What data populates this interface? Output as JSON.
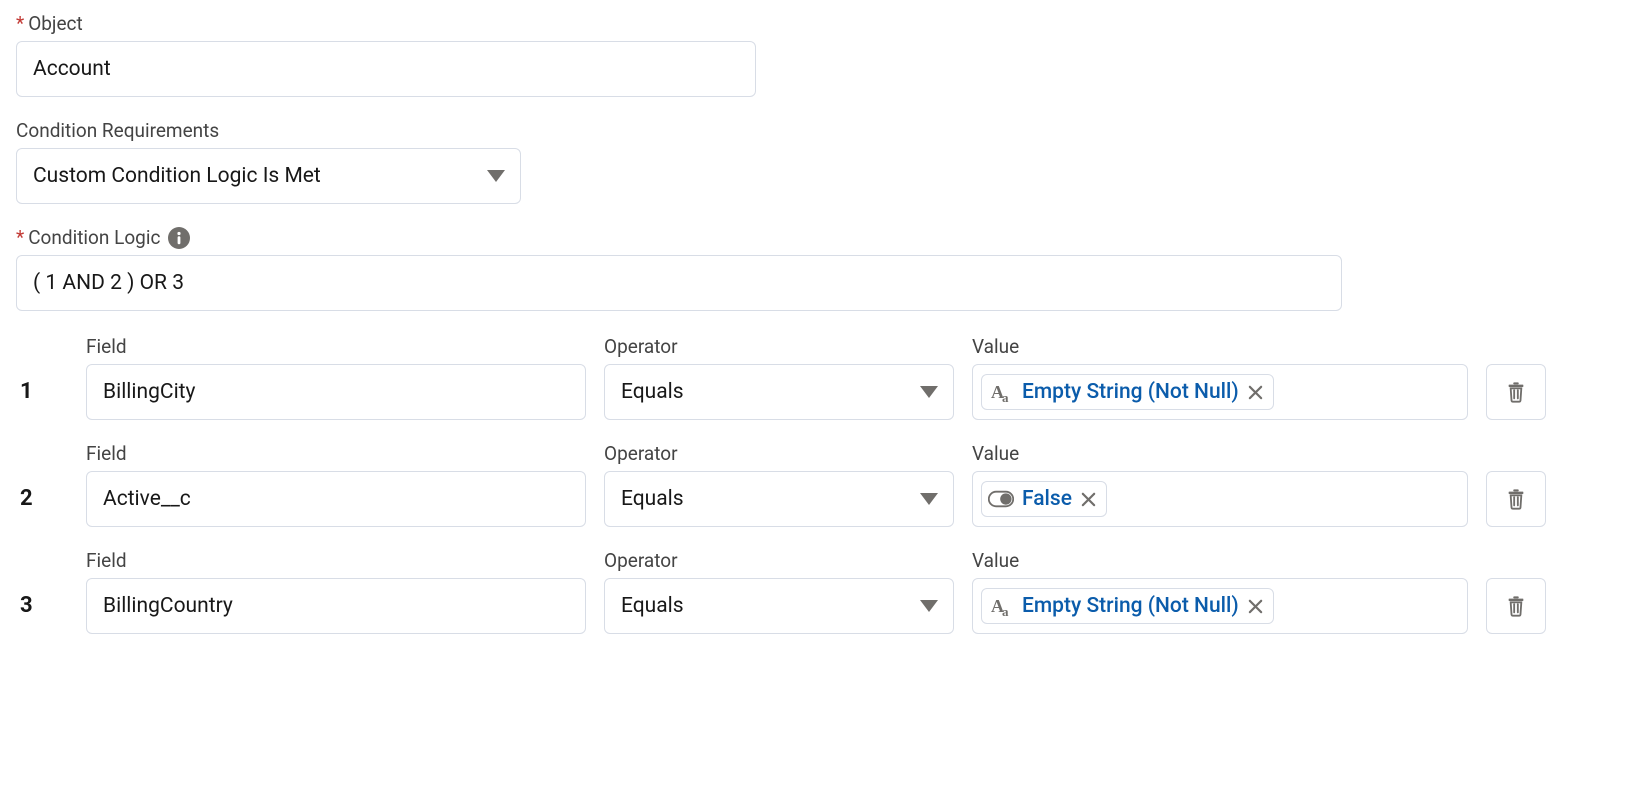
{
  "object": {
    "label": "Object",
    "value": "Account"
  },
  "requirements": {
    "label": "Condition Requirements",
    "selected": "Custom Condition Logic Is Met"
  },
  "conditionLogic": {
    "label": "Condition Logic",
    "value": "( 1 AND 2 ) OR 3"
  },
  "columns": {
    "field": "Field",
    "operator": "Operator",
    "value": "Value"
  },
  "rows": [
    {
      "num": "1",
      "field": "BillingCity",
      "operator": "Equals",
      "valueIcon": "text-icon",
      "valueText": "Empty String (Not Null)"
    },
    {
      "num": "2",
      "field": "Active__c",
      "operator": "Equals",
      "valueIcon": "toggle-icon",
      "valueText": "False"
    },
    {
      "num": "3",
      "field": "BillingCountry",
      "operator": "Equals",
      "valueIcon": "text-icon",
      "valueText": "Empty String (Not Null)"
    }
  ]
}
